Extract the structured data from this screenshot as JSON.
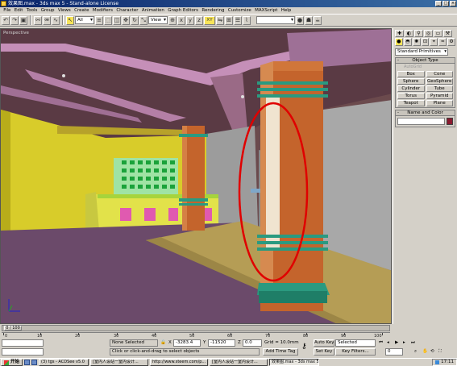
{
  "window": {
    "title": "效果图.max - 3ds max 5 - Stand-alone License"
  },
  "menu": [
    "File",
    "Edit",
    "Tools",
    "Group",
    "Views",
    "Create",
    "Modifiers",
    "Character",
    "Animation",
    "Graph Editors",
    "Rendering",
    "Customize",
    "MAXScript",
    "Help"
  ],
  "toolbar": {
    "selection_filter": "All",
    "ref_coord": "View",
    "axis_xy": "XY",
    "named_sets": ""
  },
  "viewport": {
    "label": "Perspective"
  },
  "command_panel": {
    "primitive_type": "Standard Primitives",
    "object_type_header": "Object Type",
    "autogrid": "AutoGrid",
    "buttons": [
      "Box",
      "Cone",
      "Sphere",
      "GeoSphere",
      "Cylinder",
      "Tube",
      "Torus",
      "Pyramid",
      "Teapot",
      "Plane"
    ],
    "name_color_header": "Name and Color",
    "color": "#8b1a2f"
  },
  "timeline": {
    "frame_indicator": "0 / 100",
    "ticks": [
      "0",
      "10",
      "20",
      "30",
      "40",
      "50",
      "60",
      "70",
      "80",
      "90",
      "100"
    ]
  },
  "status": {
    "selection": "None Selected",
    "prompt": "Click or click-and-drag to select objects",
    "x_label": "X",
    "x_value": "-3283.4",
    "y_label": "Y",
    "y_value": "-11520",
    "z_label": "Z",
    "z_value": "0.0",
    "grid": "Grid = 10.0mm",
    "add_time_tag": "Add Time Tag",
    "auto_key": "Auto Key",
    "set_key": "Set Key",
    "key_mode": "Selected",
    "key_filters": "Key Filters...",
    "frame": "0"
  },
  "taskbar": {
    "start": "开始",
    "tasks": [
      "效果图.max - 3ds max 5",
      "(3) tgs - ACDSee v5.0",
      "[室内人设站一室内设计...",
      "http://www.steem.com/p...",
      "[室内人设站一室内设计..."
    ],
    "clock": "17:11"
  },
  "colors": {
    "annotation": "#e00000",
    "column": "#c4642c",
    "ceiling": "#5a3a44",
    "floor": "#b59d55",
    "wall_yellow": "#d8cc2a"
  }
}
